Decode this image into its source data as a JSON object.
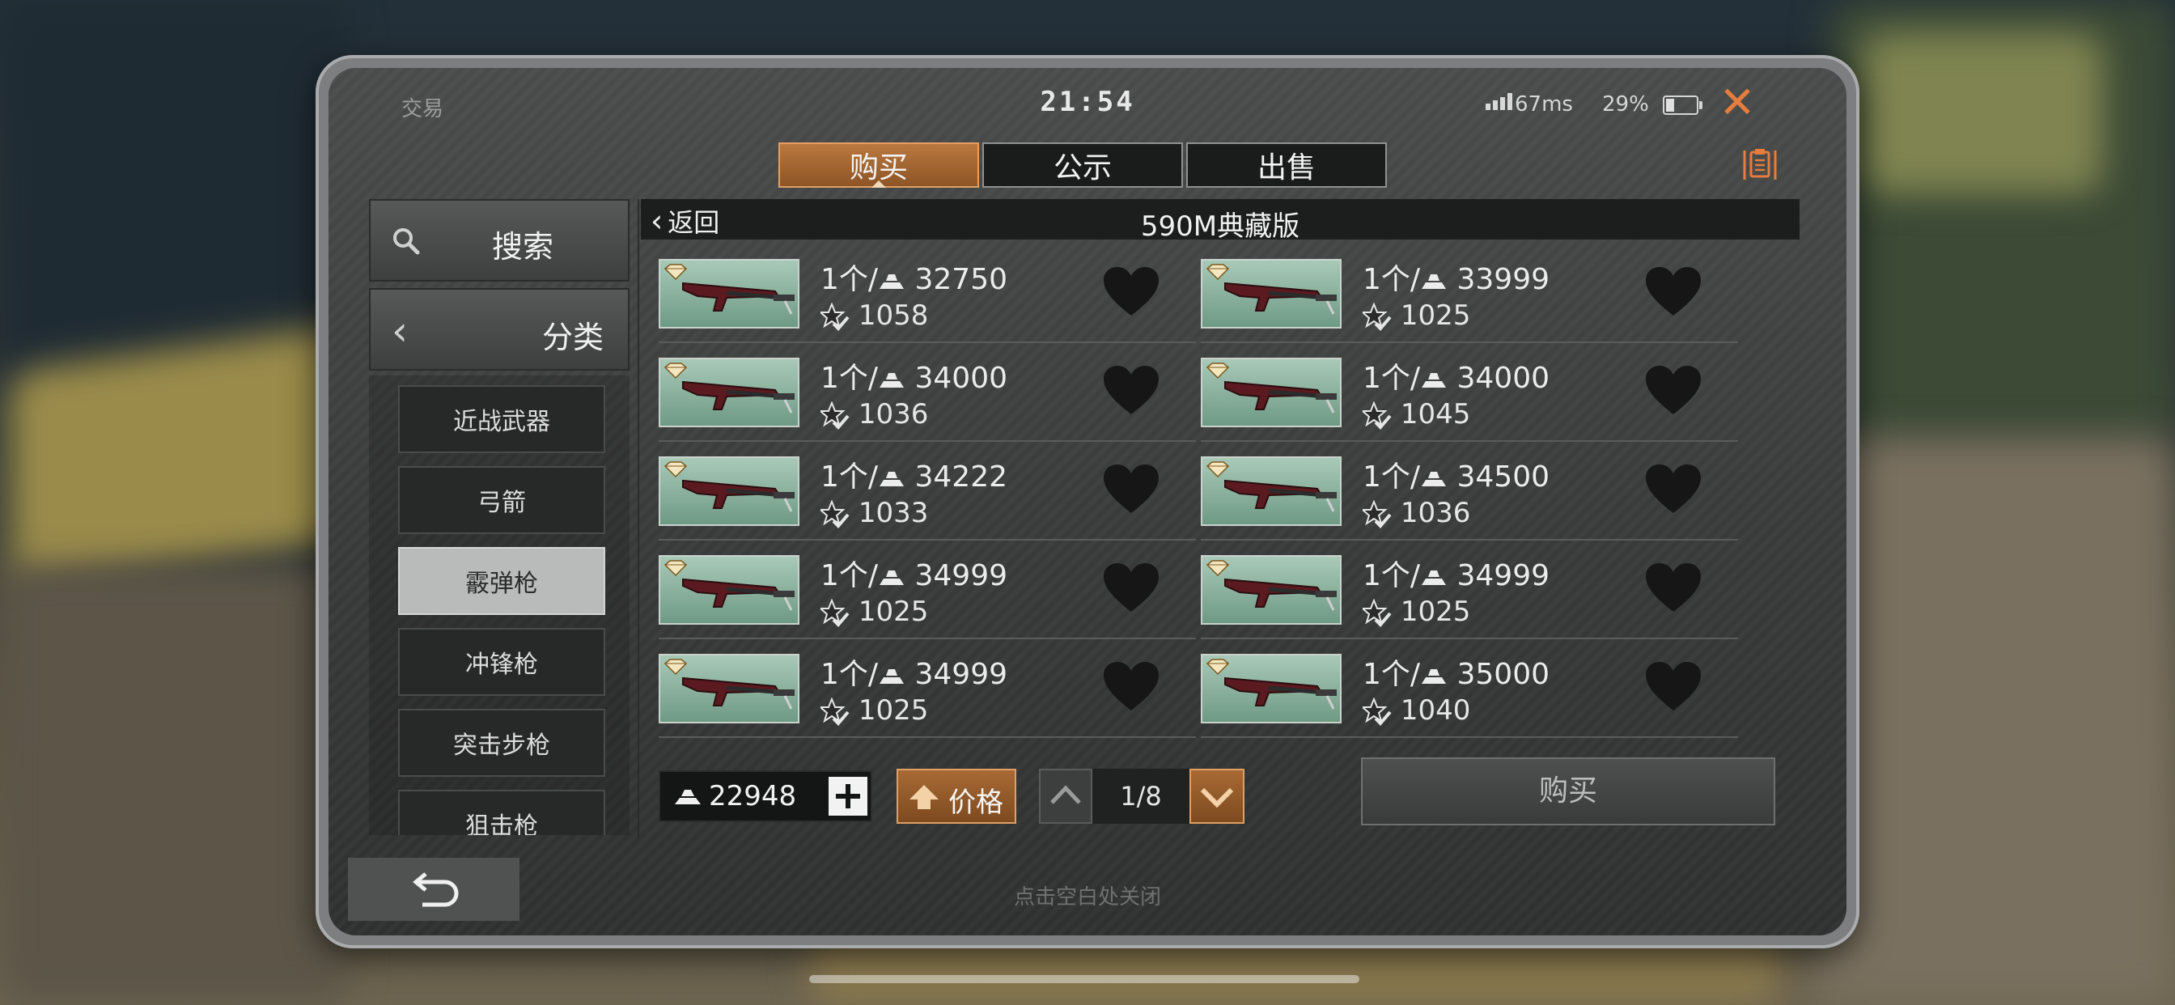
{
  "status": {
    "title": "交易",
    "time": "21:54",
    "ping": "67ms",
    "battery": "29%",
    "battery_level": 0.29
  },
  "tabs": [
    {
      "label": "购买",
      "active": true
    },
    {
      "label": "公示",
      "active": false
    },
    {
      "label": "出售",
      "active": false
    }
  ],
  "sidebar": {
    "search_label": "搜索",
    "category_label": "分类",
    "categories": [
      {
        "label": "近战武器",
        "selected": false
      },
      {
        "label": "弓箭",
        "selected": false
      },
      {
        "label": "霰弹枪",
        "selected": true
      },
      {
        "label": "冲锋枪",
        "selected": false
      },
      {
        "label": "突击步枪",
        "selected": false
      },
      {
        "label": "狙击枪",
        "selected": false
      }
    ]
  },
  "main": {
    "back_label": "返回",
    "item_title": "590M典藏版",
    "listings": [
      {
        "price": "1个/  32750",
        "rating": "1058"
      },
      {
        "price": "1个/  33999",
        "rating": "1025"
      },
      {
        "price": "1个/  34000",
        "rating": "1036"
      },
      {
        "price": "1个/  34000",
        "rating": "1045"
      },
      {
        "price": "1个/  34222",
        "rating": "1033"
      },
      {
        "price": "1个/  34500",
        "rating": "1036"
      },
      {
        "price": "1个/  34999",
        "rating": "1025"
      },
      {
        "price": "1个/  34999",
        "rating": "1025"
      },
      {
        "price": "1个/  34999",
        "rating": "1025"
      },
      {
        "price": "1个/  35000",
        "rating": "1040"
      }
    ]
  },
  "footer": {
    "balance": "22948",
    "sort_label": "价格",
    "page": "1/8",
    "buy_label": "购买",
    "hint": "点击空白处关闭"
  },
  "colors": {
    "accent": "#e67d3c",
    "active_tab": "#b9783f",
    "panel": "#3f4040"
  },
  "icons": {
    "close": "close-icon",
    "clipboard": "clipboard-icon",
    "search": "search-icon",
    "back": "chevron-left-icon",
    "favorite": "heart-icon",
    "currency": "gold-icon",
    "rating": "star-check-icon",
    "return": "return-icon"
  }
}
